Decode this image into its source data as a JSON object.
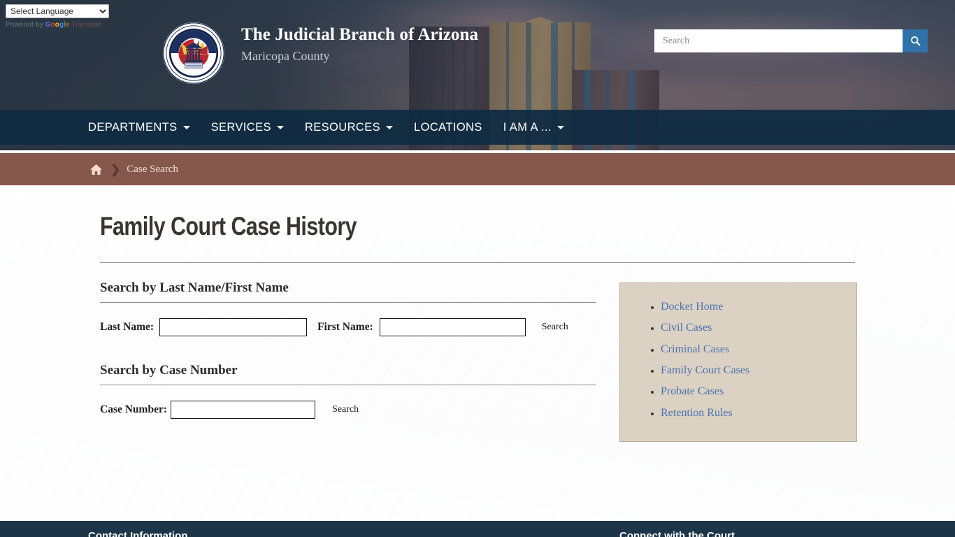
{
  "translate": {
    "select_label": "Select Language",
    "powered_prefix": "Powered by ",
    "google": [
      "G",
      "o",
      "o",
      "g",
      "l",
      "e"
    ],
    "translate_word": " Translate",
    "options": [
      "Select Language"
    ]
  },
  "brand": {
    "title": "The Judicial Branch of Arizona",
    "subtitle": "Maricopa County",
    "seal_text": "THE JUDICIAL BRANCH OF ARIZONA / MARICOPA COUNTY"
  },
  "header_search": {
    "placeholder": "Search",
    "value": "",
    "button_icon": "search-icon"
  },
  "nav": {
    "items": [
      {
        "label": "DEPARTMENTS",
        "has_dropdown": true
      },
      {
        "label": "SERVICES",
        "has_dropdown": true
      },
      {
        "label": "RESOURCES",
        "has_dropdown": true
      },
      {
        "label": "LOCATIONS",
        "has_dropdown": false
      },
      {
        "label": "I AM A ...",
        "has_dropdown": true
      }
    ]
  },
  "breadcrumb": {
    "home_icon": "home-icon",
    "separator": "❯",
    "current": "Case Search"
  },
  "page": {
    "title": "Family Court Case History"
  },
  "sections": {
    "name_search": {
      "heading": "Search by Last Name/First Name",
      "last_name_label": "Last Name:",
      "last_name_value": "",
      "first_name_label": "First Name:",
      "first_name_value": "",
      "search_button": "Search"
    },
    "case_search": {
      "heading": "Search by Case Number",
      "case_number_label": "Case Number:",
      "case_number_value": "",
      "search_button": "Search"
    }
  },
  "sidebar": {
    "links": [
      "Docket Home",
      "Civil Cases",
      "Criminal Cases",
      "Family Court Cases",
      "Probate Cases",
      "Retention Rules"
    ]
  },
  "footer": {
    "contact_heading": "Contact Information",
    "connect_heading": "Connect with the Court"
  },
  "colors": {
    "nav_bg": "#0f2b42",
    "breadcrumb_bg": "#86574c",
    "search_button": "#3071a9",
    "sidebar_bg": "#dcd2c4",
    "link_blue": "#4a72ae",
    "footer_bg": "#1d3548"
  }
}
